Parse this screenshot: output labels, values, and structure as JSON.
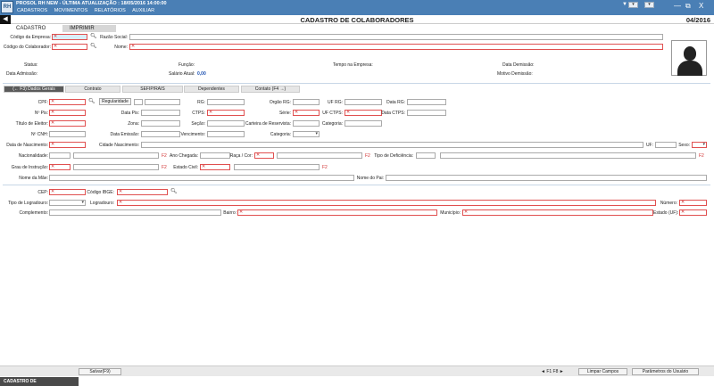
{
  "app": {
    "title": "PROSOL RH NEW - ÚLTIMA ATUALIZAÇÃO : 18/05/2016 14:00:00",
    "menu": [
      "CADASTROS",
      "MOVIMENTOS",
      "RELATÓRIOS",
      "AUXILIAR"
    ],
    "window_controls": [
      "—",
      "⧉",
      "X"
    ]
  },
  "page": {
    "title": "CADASTRO DE COLABORADORES",
    "date": "04/2016"
  },
  "top_tabs": [
    "CADASTRO",
    "IMPRIMIR"
  ],
  "header_fields": {
    "codigo_empresa": "Código da Empresa:",
    "razao_social": "Razão Social:",
    "codigo_colaborador": "Código do Colaborador:",
    "nome": "Nome:"
  },
  "info": {
    "status": "Status:",
    "funcao": "Função:",
    "tempo_empresa": "Tempo na Empresa:",
    "data_demissao": "Data Demissão:",
    "data_admissao": "Data Admissão:",
    "salario_atual": "Salário Atual:",
    "salario_valor": "0,00",
    "motivo_demissao": "Motivo Demissão:"
  },
  "tabs": [
    "(← F3) Dados Gerais",
    "Contrato",
    "SEFIP/RAIS",
    "Dependentes",
    "Contato (F4 →)"
  ],
  "labels": {
    "cpf": "CPF:",
    "regularidade": "Regularidade",
    "rg": "RG:",
    "orgao_rg": "Orgão RG:",
    "uf_rg": "UF RG:",
    "data_rg": "Data RG:",
    "pis": "Nº Pis:",
    "data_pis": "Data Pis:",
    "ctps": "CTPS:",
    "serie": "Série:",
    "uf_ctps": "UF CTPS:",
    "data_ctps": "Data CTPS:",
    "titulo_eleitor": "Título de Eleitor:",
    "zona": "Zona:",
    "secao": "Seção:",
    "reservista": "Carteira de Reservista:",
    "categoria_res": "Categoria:",
    "cnh": "Nº CNH:",
    "data_emissao": "Data Emissão:",
    "vencimento": "Vencimento:",
    "categoria_cnh": "Categoria:",
    "data_nascimento": "Data de Nascimento:",
    "cidade_nascimento": "Cidade Nascimento:",
    "uf": "UF:",
    "sexo": "Sexo:",
    "nacionalidade": "Nacionalidade:",
    "ano_chegada": "Ano Chegada:",
    "raca_cor": "Raça / Cor:",
    "tipo_deficiencia": "Tipo de Deficiência:",
    "grau_instrucao": "Grau de Instrução:",
    "estado_civil": "Estado Civil:",
    "nome_mae": "Nome da Mãe:",
    "nome_pai": "Nome do Pai:",
    "cep": "CEP:",
    "codigo_ibge": "Código IBGE:",
    "tipo_logradouro": "Tipo de Logradouro:",
    "logradouro": "Logradouro:",
    "numero": "Número:",
    "complemento": "Complemento:",
    "bairro": "Bairro:",
    "municipio": "Município:",
    "estado_uf": "Estado (UF):",
    "f2": "F2"
  },
  "bottom": {
    "salvar": "Salvar(F9)",
    "nav": "◄ F1   F8 ►",
    "limpar": "Limpar Campos",
    "parametros": "Parâmetros do Usuário"
  },
  "footer": "CADASTRO DE COLABORADORES",
  "colors": {
    "titlebar": "#4a7fb5",
    "required": "#e05050"
  },
  "icons": [
    "logo-icon",
    "search-icon",
    "back-arrow-icon",
    "avatar-placeholder-icon"
  ]
}
